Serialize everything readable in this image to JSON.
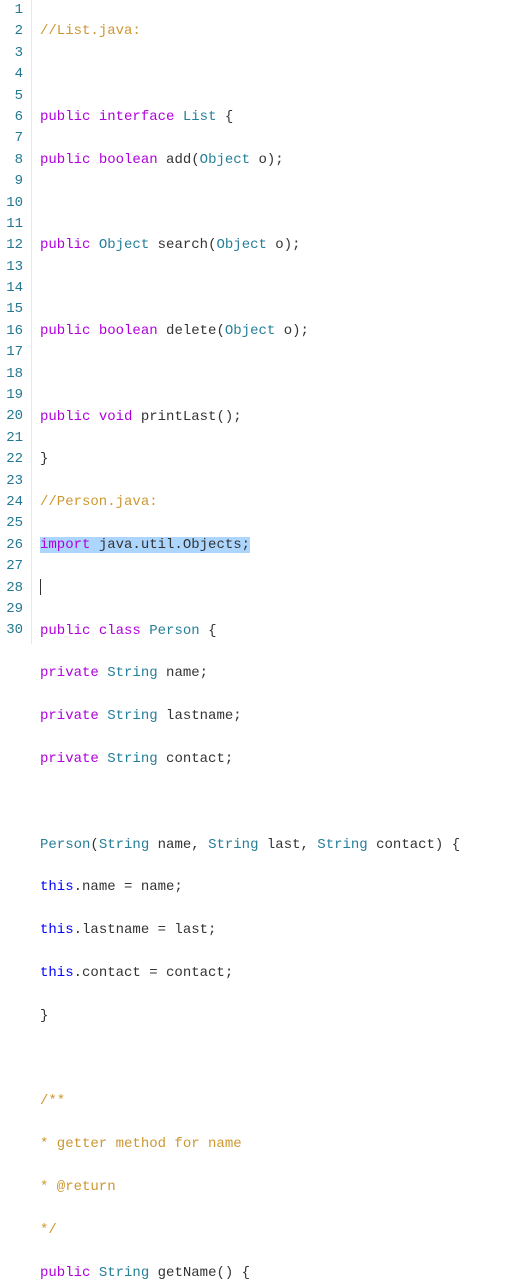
{
  "gutter": {
    "1": "1",
    "2": "2",
    "3": "3",
    "4": "4",
    "5": "5",
    "6": "6",
    "7": "7",
    "8": "8",
    "9": "9",
    "10": "10",
    "11": "11",
    "12": "12",
    "13": "13",
    "14": "14",
    "15": "15",
    "16": "16",
    "17": "17",
    "18": "18",
    "19": "19",
    "20": "20",
    "21": "21",
    "22": "22",
    "23": "23",
    "24": "24",
    "25": "25",
    "26": "26",
    "27": "27",
    "28": "28",
    "29": "29",
    "30": "30"
  },
  "code": {
    "l1": {
      "a": "//List.java:"
    },
    "l2": {
      "a": ""
    },
    "l3": {
      "a": "public",
      "b": " ",
      "c": "interface",
      "d": " ",
      "e": "List",
      "f": " {"
    },
    "l4": {
      "a": "public",
      "b": " ",
      "c": "boolean",
      "d": " ",
      "e": "add",
      "f": "(",
      "g": "Object",
      "h": " o);"
    },
    "l5": {
      "a": ""
    },
    "l6": {
      "a": "public",
      "b": " ",
      "c": "Object",
      "d": " ",
      "e": "search",
      "f": "(",
      "g": "Object",
      "h": " o);"
    },
    "l7": {
      "a": ""
    },
    "l8": {
      "a": "public",
      "b": " ",
      "c": "boolean",
      "d": " ",
      "e": "delete",
      "f": "(",
      "g": "Object",
      "h": " o);"
    },
    "l9": {
      "a": ""
    },
    "l10": {
      "a": "public",
      "b": " ",
      "c": "void",
      "d": " ",
      "e": "printLast",
      "f": "();"
    },
    "l11": {
      "a": "}"
    },
    "l12": {
      "a": "//Person.java:"
    },
    "l13": {
      "a": "import",
      "b": " java.util.Objects;"
    },
    "l14": {
      "a": ""
    },
    "l15": {
      "a": "public",
      "b": " ",
      "c": "class",
      "d": " ",
      "e": "Person",
      "f": " {"
    },
    "l16": {
      "a": "private",
      "b": " ",
      "c": "String",
      "d": " name;"
    },
    "l17": {
      "a": "private",
      "b": " ",
      "c": "String",
      "d": " lastname;"
    },
    "l18": {
      "a": "private",
      "b": " ",
      "c": "String",
      "d": " contact;"
    },
    "l19": {
      "a": ""
    },
    "l20": {
      "a": "Person",
      "b": "(",
      "c": "String",
      "d": " name, ",
      "e": "String",
      "f": " last, ",
      "g": "String",
      "h": " contact) {"
    },
    "l21": {
      "a": "this",
      "b": ".name = name;"
    },
    "l22": {
      "a": "this",
      "b": ".lastname = last;"
    },
    "l23": {
      "a": "this",
      "b": ".contact = contact;"
    },
    "l24": {
      "a": "}"
    },
    "l25": {
      "a": ""
    },
    "l26": {
      "a": "/**"
    },
    "l27": {
      "a": "* getter method for name"
    },
    "l28": {
      "a": "* @return"
    },
    "l29": {
      "a": "*/"
    },
    "l30": {
      "a": "public",
      "b": " ",
      "c": "String",
      "d": " ",
      "e": "getName",
      "f": "() {"
    }
  }
}
